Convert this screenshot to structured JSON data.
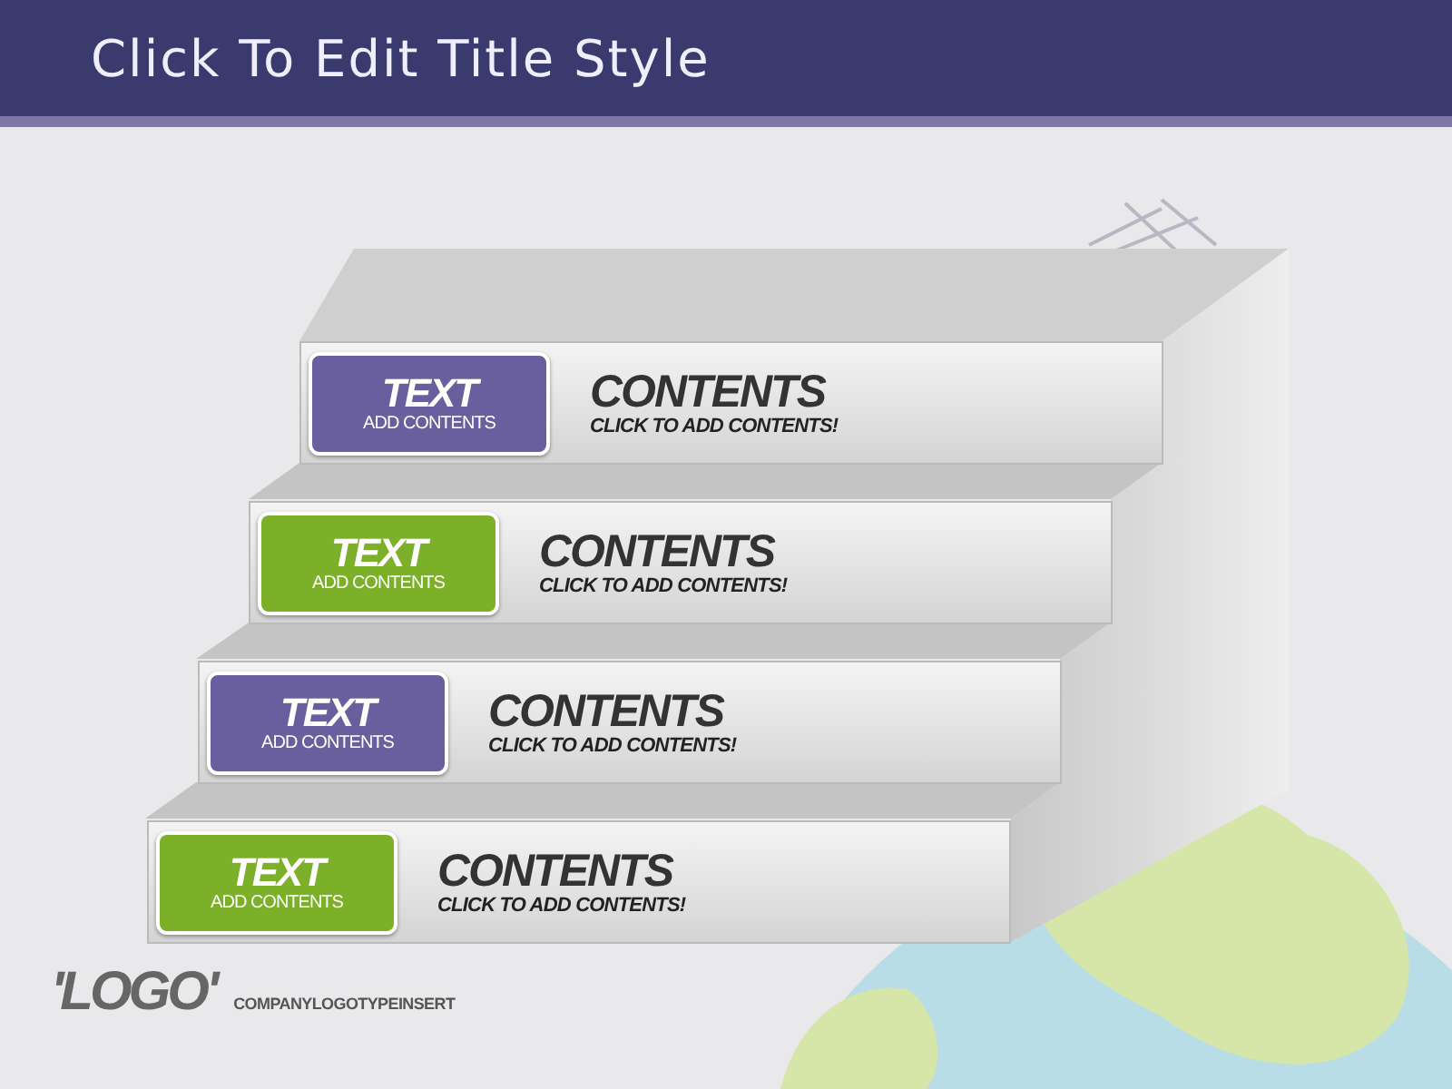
{
  "title": "Click To Edit Title Style",
  "steps": [
    {
      "tag_title": "TEXT",
      "tag_subtitle": "ADD CONTENTS",
      "color": "#6a5f9e",
      "heading": "CONTENTS",
      "text": "CLICK TO ADD CONTENTS!"
    },
    {
      "tag_title": "TEXT",
      "tag_subtitle": "ADD CONTENTS",
      "color": "#7cb028",
      "heading": "CONTENTS",
      "text": "CLICK TO ADD CONTENTS!"
    },
    {
      "tag_title": "TEXT",
      "tag_subtitle": "ADD CONTENTS",
      "color": "#6a5f9e",
      "heading": "CONTENTS",
      "text": "CLICK TO ADD CONTENTS!"
    },
    {
      "tag_title": "TEXT",
      "tag_subtitle": "ADD CONTENTS",
      "color": "#7cb028",
      "heading": "CONTENTS",
      "text": "CLICK TO ADD CONTENTS!"
    }
  ],
  "logo": {
    "mark": "'LOGO'",
    "tagline": "COMPANYLOGOTYPEINSERT"
  }
}
